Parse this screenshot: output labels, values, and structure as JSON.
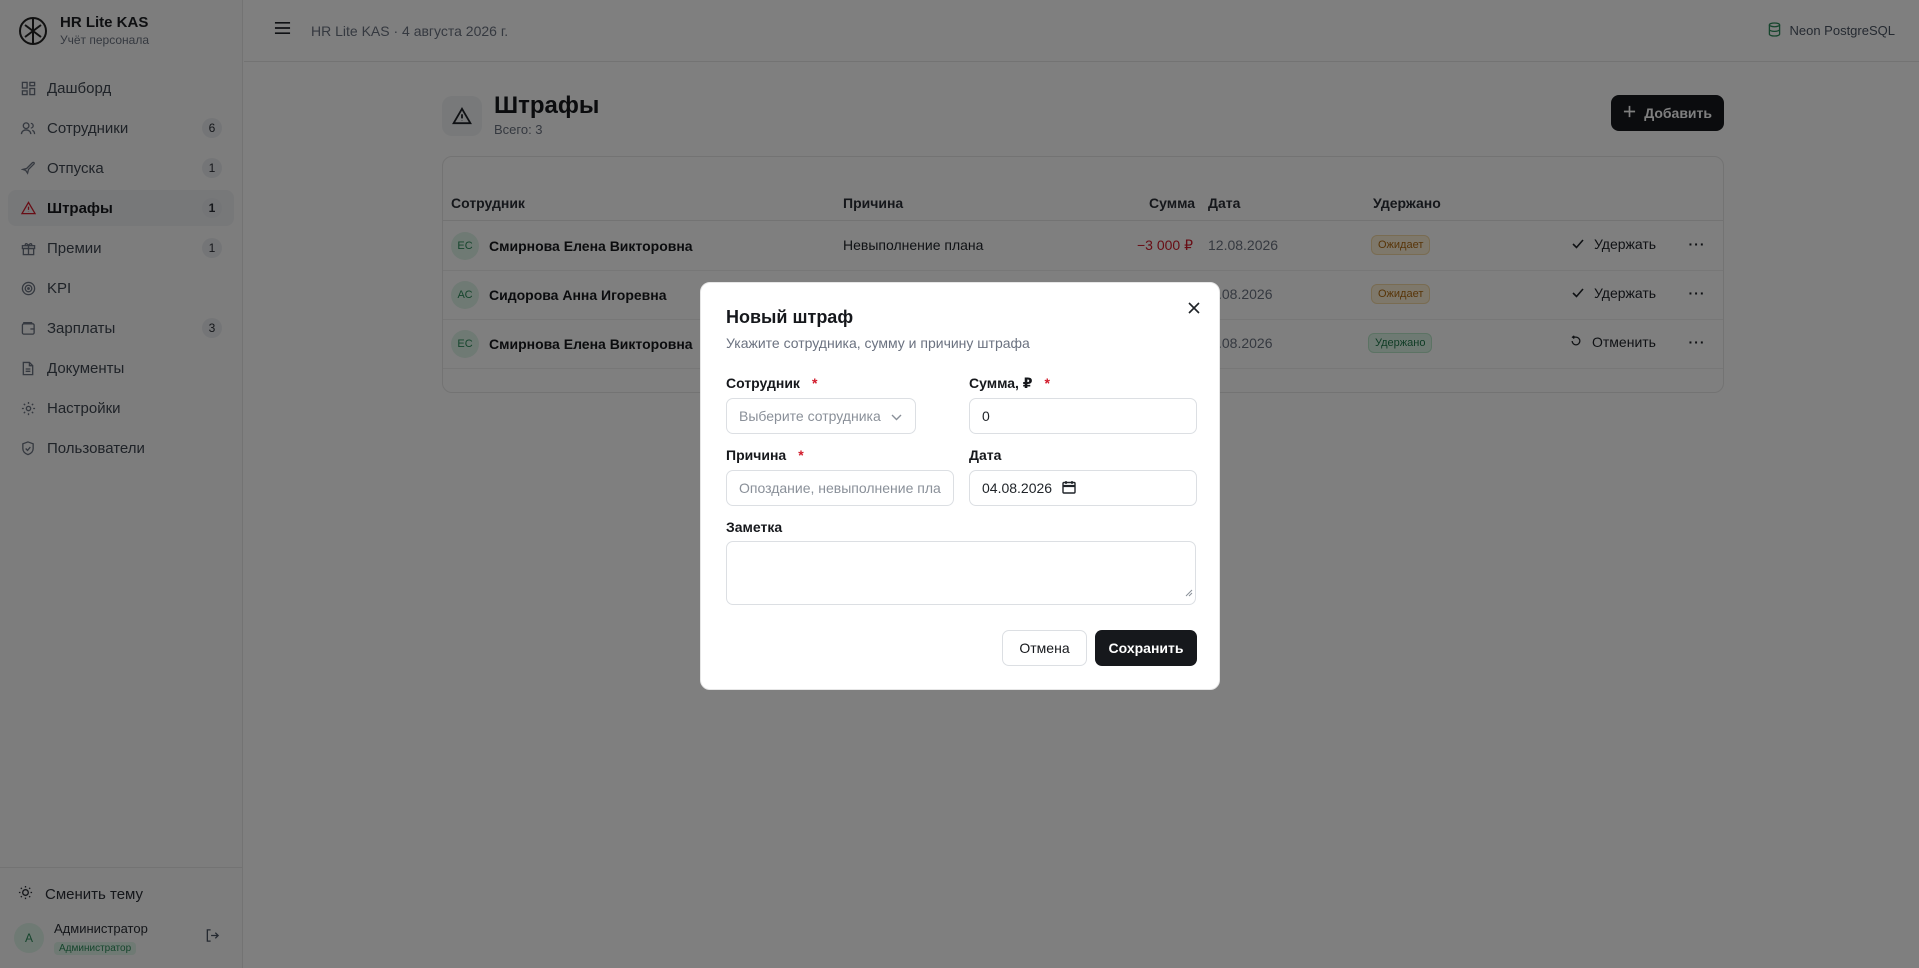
{
  "brand": {
    "title": "HR Lite KAS",
    "subtitle": "Учёт персонала"
  },
  "sidebar": {
    "items": [
      {
        "label": "Дашборд",
        "icon": "dashboard-icon",
        "count": ""
      },
      {
        "label": "Сотрудники",
        "icon": "users-icon",
        "count": "6"
      },
      {
        "label": "Отпуска",
        "icon": "plane-icon",
        "count": "1"
      },
      {
        "label": "Штрафы",
        "icon": "warning-icon",
        "count": "1",
        "active": true
      },
      {
        "label": "Премии",
        "icon": "gift-icon",
        "count": "1"
      },
      {
        "label": "KPI",
        "icon": "target-icon",
        "count": ""
      },
      {
        "label": "Зарплаты",
        "icon": "wallet-icon",
        "count": "3"
      },
      {
        "label": "Документы",
        "icon": "document-icon",
        "count": ""
      },
      {
        "label": "Настройки",
        "icon": "gear-icon",
        "count": ""
      },
      {
        "label": "Пользователи",
        "icon": "shield-icon",
        "count": ""
      }
    ],
    "theme_label": "Сменить тему",
    "user": {
      "initial": "А",
      "name": "Администратор",
      "role": "Администратор"
    }
  },
  "topbar": {
    "breadcrumb": "HR Lite KAS · 4 августа 2026 г.",
    "db_label": "Neon PostgreSQL"
  },
  "page": {
    "title": "Штрафы",
    "subtitle": "Всего: 3",
    "add_label": "Добавить"
  },
  "table": {
    "headers": {
      "employee": "Сотрудник",
      "reason": "Причина",
      "sum": "Сумма",
      "date": "Дата",
      "withheld": "Удержано"
    },
    "rows": [
      {
        "initials": "ЕС",
        "name": "Смирнова Елена Викторовна",
        "reason": "Невыполнение плана",
        "sum": "−3 000 ₽",
        "date": "12.08.2026",
        "status": "Ожидает",
        "action": "Удержать"
      },
      {
        "initials": "АС",
        "name": "Сидорова Анна Игоревна",
        "reason": "",
        "sum": "",
        "date": ".08.2026",
        "status": "Ожидает",
        "action": "Удержать"
      },
      {
        "initials": "ЕС",
        "name": "Смирнова Елена Викторовна",
        "reason": "",
        "sum": "",
        "date": ".08.2026",
        "status": "Удержано",
        "action": "Отменить"
      }
    ]
  },
  "modal": {
    "title": "Новый штраф",
    "description": "Укажите сотрудника, сумму и причину штрафа",
    "employee_label": "Сотрудник",
    "employee_placeholder": "Выберите сотрудника",
    "sum_label": "Сумма, ₽",
    "sum_value": "0",
    "reason_label": "Причина",
    "reason_placeholder": "Опоздание, невыполнение пла",
    "date_label": "Дата",
    "date_value": "04.08.2026",
    "note_label": "Заметка",
    "required_mark": "*",
    "cancel_label": "Отмена",
    "save_label": "Сохранить"
  },
  "colors": {
    "accent": "#16181c",
    "danger": "#d11a2a",
    "success": "#2c8b5a",
    "warning": "#b06a10"
  }
}
